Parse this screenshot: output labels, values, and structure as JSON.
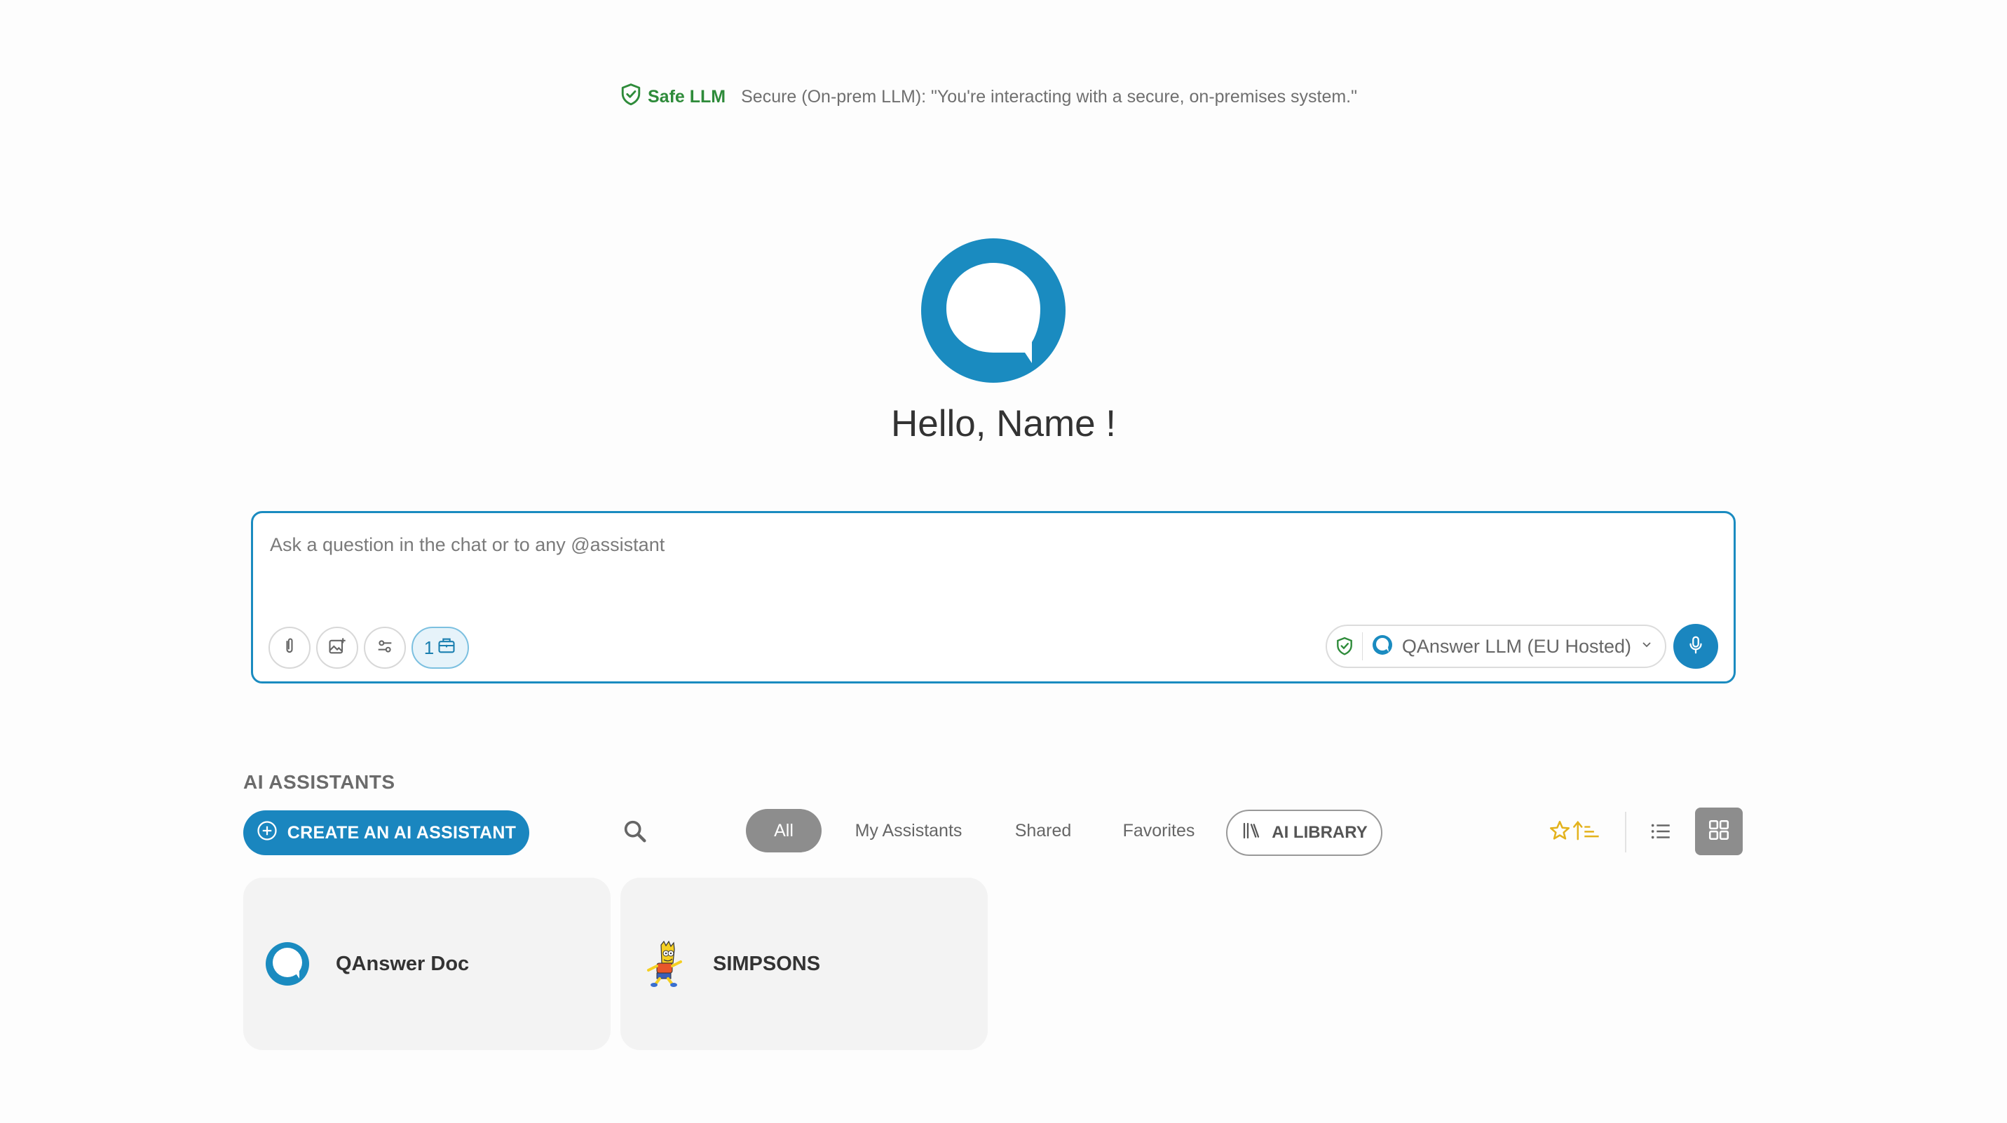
{
  "banner": {
    "badge_label": "Safe LLM",
    "description": "Secure (On-prem LLM): \"You're interacting with a secure, on-premises system.\""
  },
  "greeting": "Hello, Name !",
  "chat": {
    "placeholder": "Ask a question in the chat or to any @assistant",
    "tools": [
      {
        "icon": "paperclip-icon"
      },
      {
        "icon": "image-add-icon"
      },
      {
        "icon": "sliders-icon"
      },
      {
        "icon": "briefcase-icon",
        "count": "1"
      }
    ],
    "model": {
      "name": "QAnswer LLM (EU Hosted)"
    }
  },
  "assistants": {
    "section_title": "AI ASSISTANTS",
    "create_label": "CREATE AN AI ASSISTANT",
    "filters": [
      "All",
      "My Assistants",
      "Shared",
      "Favorites"
    ],
    "active_filter": "All",
    "library_label": "AI LIBRARY",
    "cards": [
      {
        "name": "QAnswer Doc",
        "icon": "qanswer-logo-icon"
      },
      {
        "name": "SIMPSONS",
        "icon": "bart-simpson-avatar-icon"
      }
    ]
  },
  "colors": {
    "accent": "#1a86bf",
    "safe_green": "#2e8b3a",
    "sort_gold": "#e3b21c"
  }
}
